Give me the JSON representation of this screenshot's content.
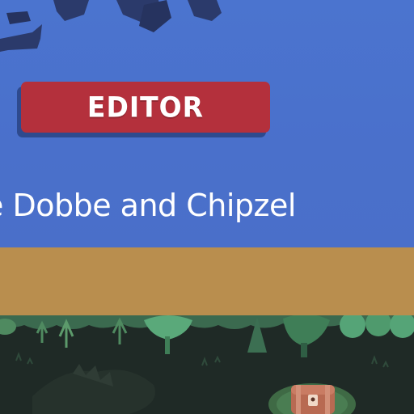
{
  "menu": {
    "editor_label": "EDITOR",
    "credit_line": "e Dobbe and Chipzel"
  },
  "icons": {
    "treasure_chest": "treasure-chest-icon"
  },
  "colors": {
    "background_blue": "#4a74cf",
    "button_red": "#b4303c",
    "band_tan": "#b98e4e",
    "forest_dark": "#1f2a26"
  }
}
